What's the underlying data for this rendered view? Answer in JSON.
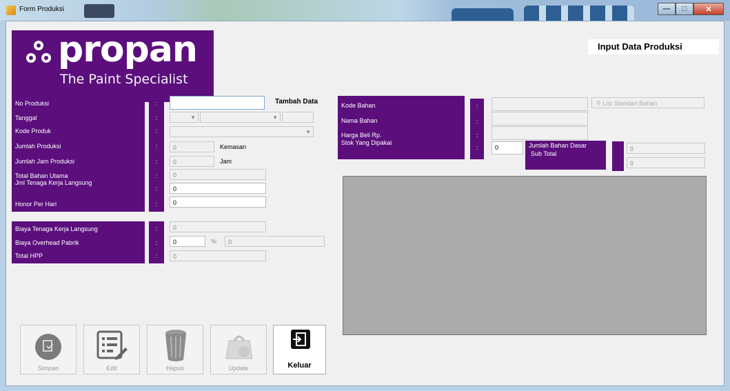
{
  "window": {
    "title": "Form Produksi",
    "controls": [
      "min",
      "max",
      "close"
    ]
  },
  "logo": {
    "brand": "propan",
    "tagline": "The Paint Specialist"
  },
  "heading": "Input Data Produksi",
  "left_form": {
    "labels": [
      "No Produksi",
      "Tanggal",
      "Kode Produk",
      "Jumlah Produksi",
      "Jumlah Jam Produksi",
      "Total Bahan Utama",
      "Jml Tenaga Kerja Langsung",
      "Honor Per Hari"
    ],
    "colons": [
      ":",
      ":",
      ":",
      ":",
      ":",
      ":",
      ":",
      ":"
    ],
    "no_produksi": "",
    "tambah_data": "Tambah Data",
    "jumlah_produksi": "0",
    "kemasan_label": "Kemasan",
    "jumlah_jam": "0",
    "jam_label": "Jam",
    "total_bahan_utama": "0",
    "jml_tenaga_kerja": "0",
    "honor_per_hari": "0"
  },
  "cost_form": {
    "labels": [
      "Biaya Tenaga Kerja Langsung",
      "Biaya Overhead Pabrik",
      "Total HPP"
    ],
    "colons": [
      ":",
      ":",
      ":"
    ],
    "biaya_tenaga_kerja": "0",
    "biaya_overhead": "0",
    "overhead_unit": "%",
    "overhead_result": "0",
    "total_hpp": "0"
  },
  "bahan_form": {
    "labels": [
      "Kode Bahan",
      "Nama Bahan",
      "Harga Beli Rp.",
      "Stok Yang Dipakai"
    ],
    "colons": [
      ":",
      ":",
      ":",
      ":"
    ],
    "list_button": "List Standart Bahan",
    "stok_dipakai": "0",
    "jumlah_bahan_dasar_label": "Jumlah Bahan Dasar",
    "subtotal_label": "Sub Total",
    "jumlah_bahan_dasar": "0",
    "subtotal": "0"
  },
  "buttons": [
    {
      "label": "Simpan",
      "icon": "save-icon",
      "enabled": false
    },
    {
      "label": "Edit",
      "icon": "edit-list-icon",
      "enabled": false
    },
    {
      "label": "Hapus",
      "icon": "trash-icon",
      "enabled": false
    },
    {
      "label": "Update",
      "icon": "update-icon",
      "enabled": false
    },
    {
      "label": "Keluar",
      "icon": "exit-icon",
      "enabled": true
    }
  ],
  "colors": {
    "brand_purple": "#5b0e7c",
    "grid_gray": "#ababab"
  }
}
